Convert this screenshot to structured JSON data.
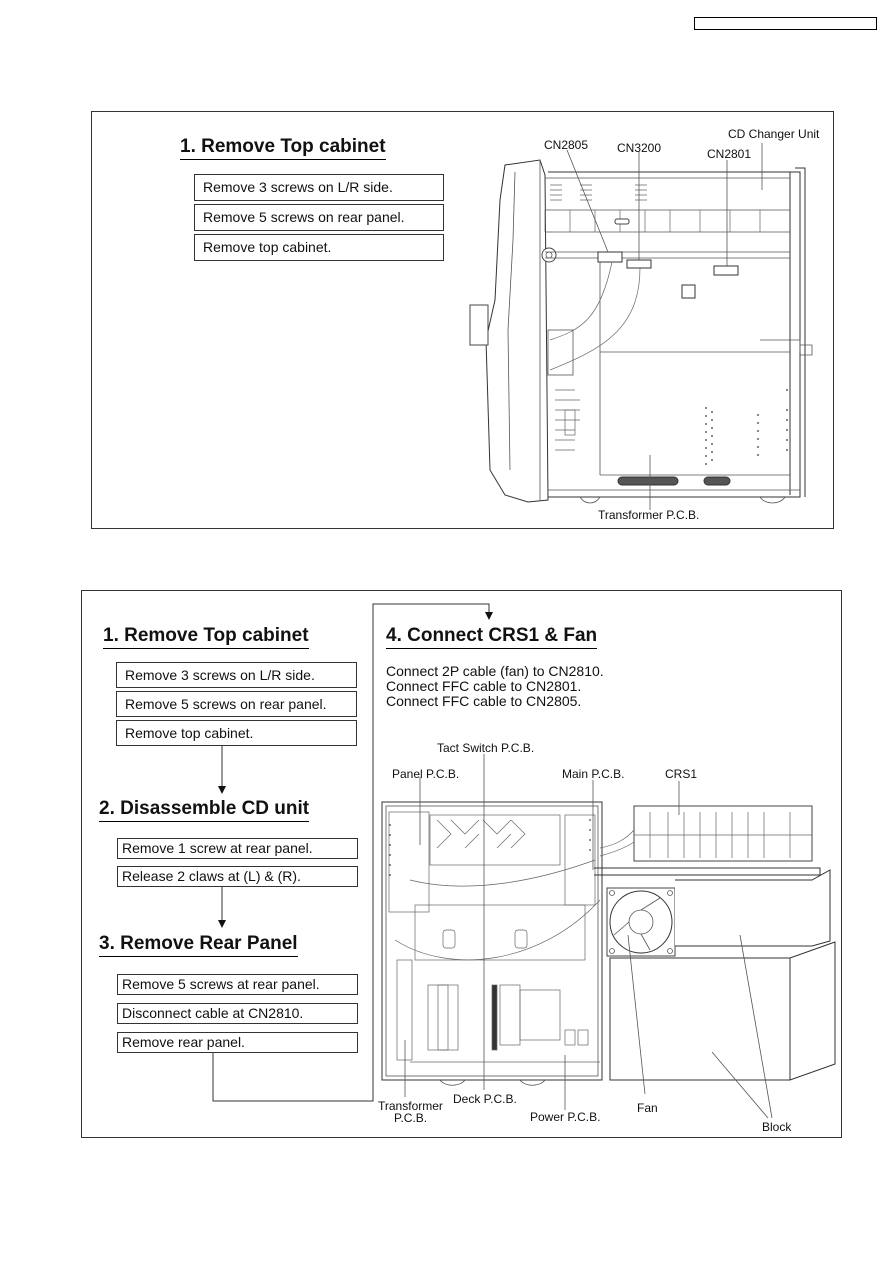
{
  "page": {
    "header_box_text": ""
  },
  "top_section": {
    "step1": {
      "title": "1. Remove Top cabinet",
      "steps": [
        "Remove 3 screws on L/R side.",
        "Remove 5 screws on rear panel.",
        "Remove top cabinet."
      ]
    },
    "callouts": {
      "cn2805": "CN2805",
      "cn3200": "CN3200",
      "cn2801": "CN2801",
      "cd_changer": "CD Changer Unit",
      "transformer": "Transformer P.C.B."
    }
  },
  "bottom_section": {
    "step1": {
      "title": "1. Remove Top cabinet",
      "steps": [
        "Remove 3 screws on L/R side.",
        "Remove 5 screws on rear panel.",
        "Remove top cabinet."
      ]
    },
    "step2": {
      "title": "2. Disassemble CD unit",
      "steps": [
        "Remove 1 screw at rear panel.",
        "Release 2 claws at (L) & (R)."
      ]
    },
    "step3": {
      "title": "3. Remove Rear Panel",
      "steps": [
        "Remove 5 screws at rear panel.",
        "Disconnect cable at CN2810.",
        "Remove rear panel."
      ]
    },
    "step4": {
      "title": "4. Connect CRS1 & Fan",
      "instructions": [
        "Connect 2P cable (fan) to CN2810.",
        "Connect FFC cable to CN2801.",
        "Connect FFC cable to CN2805."
      ]
    },
    "callouts": {
      "tact_switch": "Tact Switch P.C.B.",
      "panel_pcb": "Panel P.C.B.",
      "main_pcb": "Main P.C.B.",
      "crs1": "CRS1",
      "transformer_line1": "Transformer",
      "transformer_line2": "P.C.B.",
      "deck_pcb": "Deck P.C.B.",
      "power_pcb": "Power P.C.B.",
      "fan": "Fan",
      "block": "Block"
    }
  }
}
